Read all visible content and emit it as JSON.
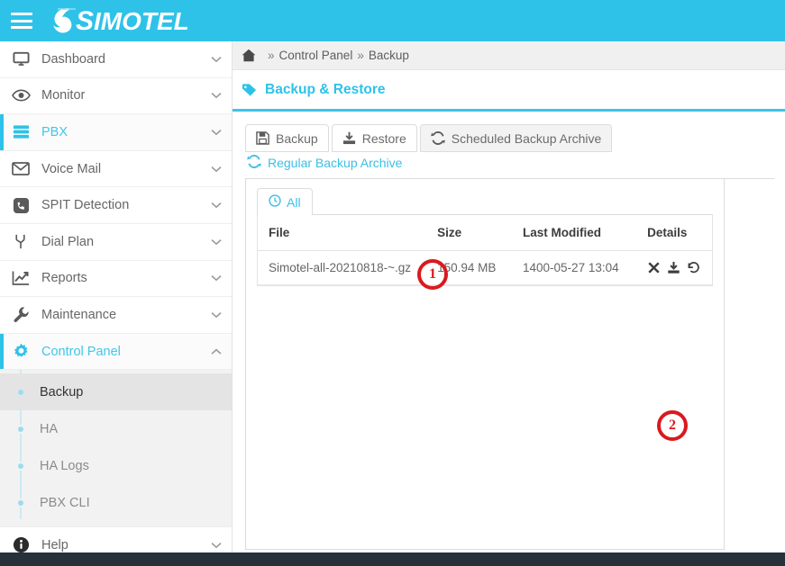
{
  "header": {
    "menu_icon": "hamburger-icon",
    "logo_text": "SIMOTEL",
    "logo_cap": "S",
    "logo_rest": "IMOTEL",
    "brand_color": "#2ec2e9"
  },
  "sidebar": {
    "items": [
      {
        "label": "Dashboard",
        "icon": "monitor-icon",
        "chevron": "chevron-down",
        "active": false
      },
      {
        "label": "Monitor",
        "icon": "eye-icon",
        "chevron": "chevron-down",
        "active": false
      },
      {
        "label": "PBX",
        "icon": "server-icon",
        "chevron": "chevron-down",
        "active": false
      },
      {
        "label": "Voice Mail",
        "icon": "envelope-icon",
        "chevron": "chevron-down",
        "active": false
      },
      {
        "label": "SPIT Detection",
        "icon": "phone-icon",
        "chevron": "chevron-down",
        "active": false
      },
      {
        "label": "Dial Plan",
        "icon": "dial-plan-icon",
        "chevron": "chevron-down",
        "active": false
      },
      {
        "label": "Reports",
        "icon": "chart-line-icon",
        "chevron": "chevron-down",
        "active": false
      },
      {
        "label": "Maintenance",
        "icon": "wrench-icon",
        "chevron": "chevron-down",
        "active": false
      },
      {
        "label": "Control Panel",
        "icon": "gear-icon",
        "chevron": "chevron-up",
        "active": true
      }
    ],
    "submenu": [
      {
        "label": "Backup",
        "current": true
      },
      {
        "label": "HA",
        "current": false
      },
      {
        "label": "HA Logs",
        "current": false
      },
      {
        "label": "PBX CLI",
        "current": false
      }
    ],
    "help": {
      "label": "Help",
      "icon": "info-icon",
      "chevron": "chevron-down"
    }
  },
  "breadcrumb": {
    "home_icon": "home-icon",
    "separator": "»",
    "crumbs": [
      "Control Panel",
      "Backup"
    ]
  },
  "page": {
    "title": "Backup & Restore",
    "title_icon": "tag-icon"
  },
  "tabs": [
    {
      "label": "Backup",
      "icon": "save-icon",
      "selected": false
    },
    {
      "label": "Restore",
      "icon": "upload-icon",
      "selected": false
    },
    {
      "label": "Scheduled Backup Archive",
      "icon": "refresh-icon",
      "selected": true
    }
  ],
  "subtab": {
    "label": "Regular Backup Archive",
    "icon": "refresh-icon"
  },
  "inner_tab": {
    "label": "All",
    "icon": "clock-icon"
  },
  "table": {
    "columns": [
      "File",
      "Size",
      "Last Modified",
      "Details"
    ],
    "rows": [
      {
        "file": "Simotel-all-20210818-~.gz",
        "size": "150.94 MB",
        "last_modified": "1400-05-27 13:04",
        "actions": [
          {
            "name": "delete-icon",
            "glyph": "✕"
          },
          {
            "name": "download-icon",
            "glyph": "download"
          },
          {
            "name": "restore-icon",
            "glyph": "undo"
          }
        ]
      }
    ]
  },
  "annotations": [
    {
      "number": "1",
      "color": "#d91a1f"
    },
    {
      "number": "2",
      "color": "#d91a1f"
    }
  ]
}
